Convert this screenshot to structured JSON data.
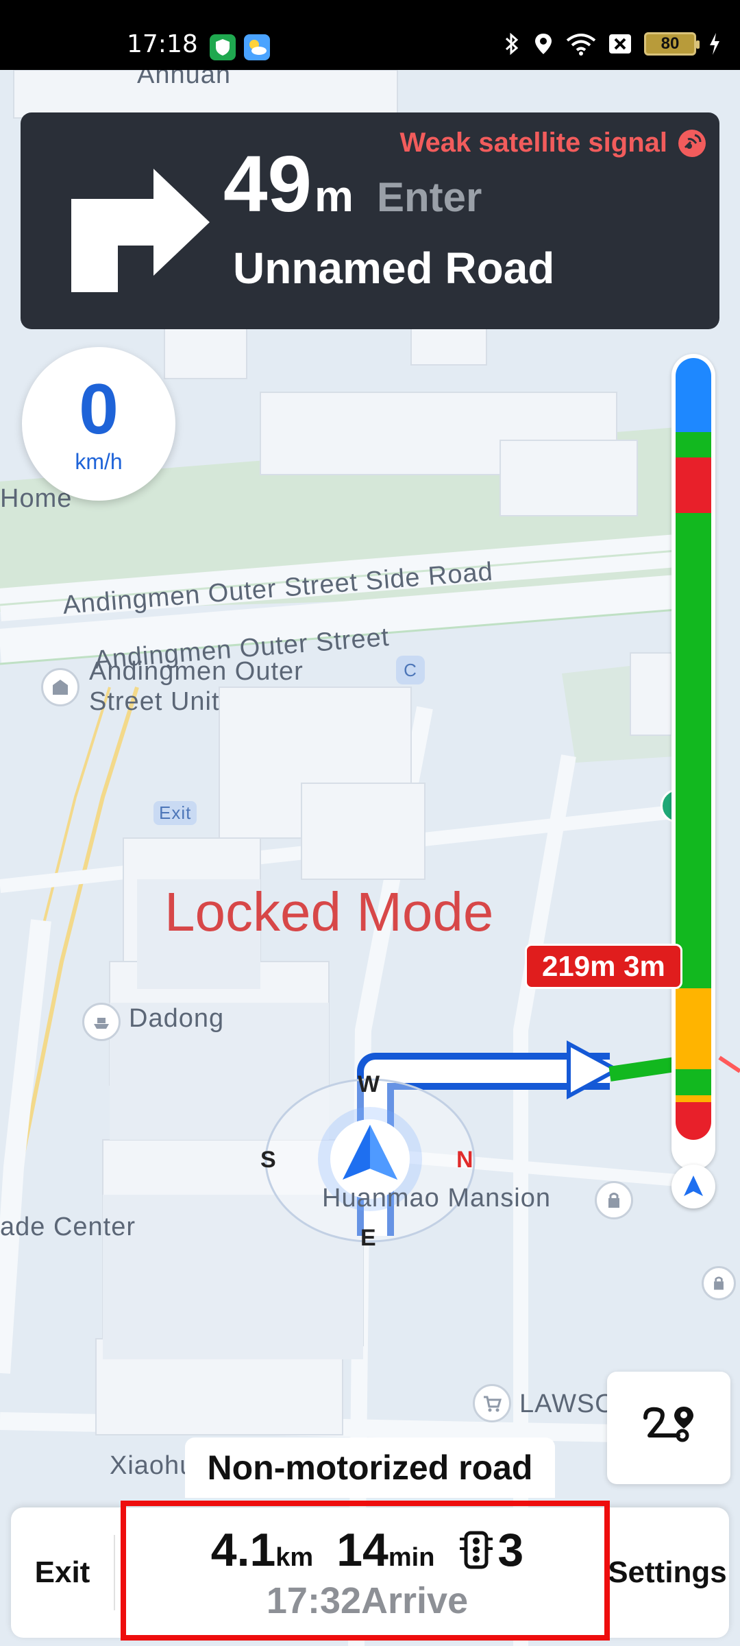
{
  "status_bar": {
    "time": "17:18",
    "battery": "80"
  },
  "nav": {
    "distance_value": "49",
    "distance_unit": "m",
    "action": "Enter",
    "road_name": "Unnamed Road",
    "satellite_warning": "Weak satellite signal"
  },
  "speed": {
    "value": "0",
    "unit": "km/h"
  },
  "map": {
    "mode_label": "Locked Mode",
    "labels": {
      "anhuan": "Anhuan",
      "home": "Home",
      "side_road": "Andingmen Outer Street Side Road",
      "outer_street": "Andingmen Outer Street",
      "unit_line1": "Andingmen Outer",
      "unit_line2": "Street Unit",
      "exit": "Exit",
      "dadong": "Dadong",
      "mansion": "Huanmao Mansion",
      "trade_center": "ade Center",
      "lawson": "LAWSO",
      "xiaohu": "Xiaohu",
      "c_badge": "C"
    },
    "compass": {
      "north": "N",
      "south": "S",
      "east": "E",
      "west": "W"
    },
    "route_callout": "219m 3m",
    "road_type": "Non-motorized road"
  },
  "traffic_bar": {
    "colors": {
      "traveled": "#1e88ff",
      "smooth": "#12b81f",
      "congested": "#e8202a",
      "slow": "#ffb400"
    },
    "segments": [
      {
        "status": "traveled",
        "from": 0.0,
        "to": 0.065
      },
      {
        "status": "smooth",
        "from": 0.065,
        "to": 0.087
      },
      {
        "status": "congested",
        "from": 0.087,
        "to": 0.136
      },
      {
        "status": "smooth",
        "from": 0.136,
        "to": 0.552
      },
      {
        "status": "slow",
        "from": 0.552,
        "to": 0.623
      },
      {
        "status": "smooth",
        "from": 0.623,
        "to": 0.646
      },
      {
        "status": "slow",
        "from": 0.646,
        "to": 0.652
      },
      {
        "status": "congested",
        "from": 0.652,
        "to": 0.685
      }
    ]
  },
  "bottom_bar": {
    "exit_label": "Exit",
    "settings_label": "Settings",
    "distance_value": "4.1",
    "distance_unit": "km",
    "time_value": "14",
    "time_unit": "min",
    "traffic_lights": "3",
    "arrival": "17:32Arrive"
  }
}
